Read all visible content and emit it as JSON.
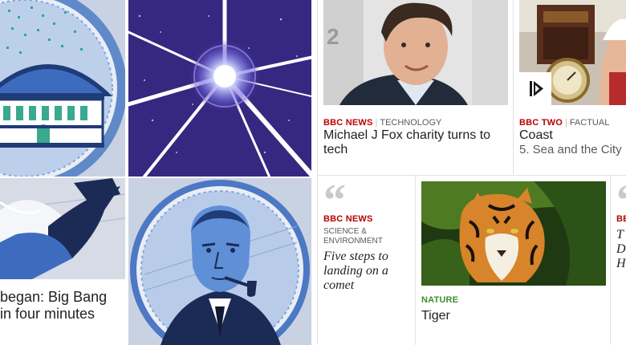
{
  "big_bang": {
    "headline_line1": "began: Big Bang",
    "headline_line2": "in four minutes"
  },
  "michael_j_fox": {
    "brand": "BBC NEWS",
    "genre": "TECHNOLOGY",
    "headline": "Michael J Fox charity turns to tech"
  },
  "coast": {
    "brand": "BBC TWO",
    "genre": "FACTUAL",
    "title": "Coast",
    "episode": "5. Sea and the City",
    "play_icon": "play-icon"
  },
  "comet": {
    "brand": "BBC NEWS",
    "genre_line1": "SCIENCE &",
    "genre_line2": "ENVIRONMENT",
    "quote": "Five steps to landing on a comet",
    "quote_mark": "“"
  },
  "tiger": {
    "brand": "NATURE",
    "title": "Tiger"
  },
  "clipped_right": {
    "quote_mark": "“",
    "brand": "BE",
    "line1": "T",
    "line2": "D",
    "line3": "H"
  },
  "colors": {
    "bbc_red": "#b80000",
    "nature_green": "#3d8e2f",
    "illustration_blue": "#3a5fb0",
    "space_purple": "#3b2a86"
  }
}
